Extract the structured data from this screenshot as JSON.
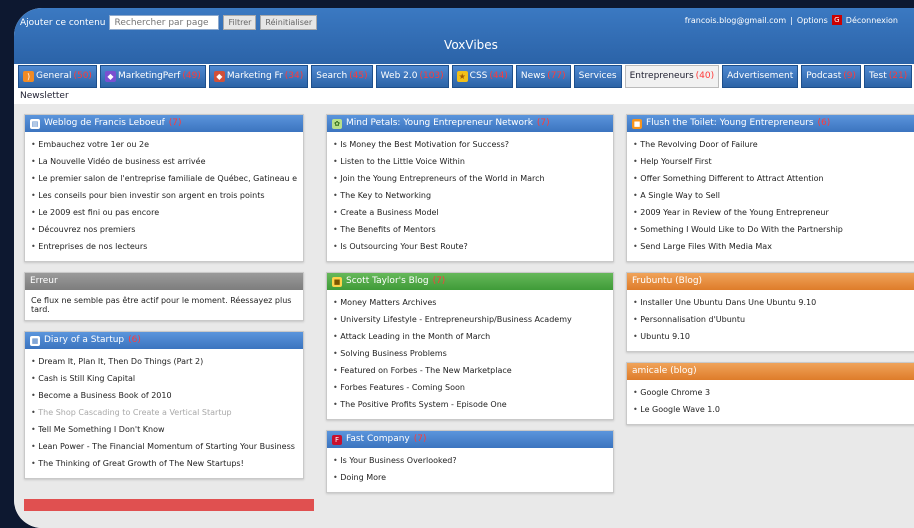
{
  "header": {
    "add_label": "Ajouter ce contenu",
    "search_placeholder": "Rechercher par page",
    "filter_btn": "Filtrer",
    "reset_btn": "Réinitialiser",
    "user_email": "francois.blog@gmail.com",
    "separator": "|",
    "options_label": "Options",
    "google_badge": "G",
    "account_label": "Déconnexion",
    "app_title": "VoxVibes"
  },
  "tabs": [
    {
      "label": "General",
      "count": "(50)",
      "icon": "rss-icon"
    },
    {
      "label": "MarketingPerf",
      "count": "(49)",
      "icon": "marketing-icon"
    },
    {
      "label": "Marketing Fr",
      "count": "(34)",
      "icon": "marketing-fr-icon"
    },
    {
      "label": "Search",
      "count": "(45)"
    },
    {
      "label": "Web 2.0",
      "count": "(103)"
    },
    {
      "label": "CSS",
      "count": "(44)",
      "icon": "star-icon"
    },
    {
      "label": "News",
      "count": "(77)"
    },
    {
      "label": "Services",
      "count": ""
    },
    {
      "label": "Entrepreneurs",
      "count": "(40)",
      "active": true
    },
    {
      "label": "Advertisement",
      "count": ""
    },
    {
      "label": "Podcast",
      "count": "(9)"
    },
    {
      "label": "Test",
      "count": "(21)"
    }
  ],
  "newsletter": "Newsletter",
  "panels": {
    "francis": {
      "title": "Weblog de Francis Leboeuf",
      "count": "(7)",
      "items": [
        "Embauchez votre 1er ou 2e",
        "La Nouvelle Vidéo de business est arrivée",
        "Le premier salon de l'entreprise familiale de Québec, Gatineau et Sherbrooke",
        "Les conseils pour bien investir son argent en trois points",
        "Le 2009 est fini ou pas encore",
        "Découvrez nos premiers",
        "Entreprises de nos lecteurs"
      ]
    },
    "error": {
      "title": "Erreur",
      "text": "Ce flux ne semble pas être actif pour le moment. Réessayez plus tard."
    },
    "diary": {
      "title": "Diary of a Startup",
      "count": "(6)",
      "items": [
        "Dream It, Plan It, Then Do Things (Part 2)",
        "Cash is Still King Capital",
        "Become a Business Book of 2010",
        "The Shop Cascading to Create a Vertical Startup",
        "Tell Me Something I Don't Know",
        "Lean Power - The Financial Momentum of Starting Your Business",
        "The Thinking of Great Growth of The New Startups!"
      ],
      "grey": [
        3
      ]
    },
    "mind": {
      "title": "Mind Petals: Young Entrepreneur Network",
      "count": "(7)",
      "items": [
        "Is Money the Best Motivation for Success?",
        "Listen to the Little Voice Within",
        "Join the Young Entrepreneurs of the World in March",
        "The Key to Networking",
        "Create a Business Model",
        "The Benefits of Mentors",
        "Is Outsourcing Your Best Route?"
      ]
    },
    "scott": {
      "title": "Scott Taylor's Blog",
      "count": "(7)",
      "items": [
        "Money Matters Archives",
        "University Lifestyle - Entrepreneurship/Business Academy",
        "Attack Leading in the Month of March",
        "Solving Business Problems",
        "Featured on Forbes - The New Marketplace",
        "Forbes Features - Coming Soon",
        "The Positive Profits System - Episode One"
      ]
    },
    "fast": {
      "title": "Fast Company",
      "count": "(7)",
      "items": [
        "Is Your Business Overlooked?",
        "Doing More"
      ]
    },
    "flush": {
      "title": "Flush the Toilet: Young Entrepreneurs",
      "count": "(6)",
      "items": [
        "The Revolving Door of Failure",
        "Help Yourself First",
        "Offer Something Different to Attract Attention",
        "A Single Way to Sell",
        "2009 Year in Review of the Young Entrepreneur",
        "Something I Would Like to Do With the Partnership",
        "Send Large Files With Media Max"
      ]
    },
    "frubuntu": {
      "title": "Frubuntu (Blog)",
      "count": "",
      "items": [
        "Installer Une Ubuntu Dans Une Ubuntu 9.10",
        "Personnalisation d'Ubuntu",
        "Ubuntu 9.10"
      ]
    },
    "amicale": {
      "title": "amicale (blog)",
      "count": "",
      "items": [
        "Google Chrome 3",
        "Le Google Wave 1.0"
      ]
    }
  }
}
